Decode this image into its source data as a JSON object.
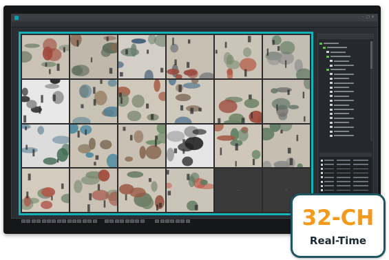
{
  "badge": {
    "title": "32-CH",
    "subtitle": "Real-Time"
  },
  "colors": {
    "accent": "#14b3b8",
    "badge_orange": "#f39a1c",
    "badge_border": "#1f5563"
  },
  "cameras": [
    {
      "state": "live",
      "palette": [
        "#c9c2b5",
        "#7f8a74",
        "#a04a3a"
      ]
    },
    {
      "state": "live",
      "palette": [
        "#bfb8ab",
        "#5d6b5a",
        "#8c6a50"
      ]
    },
    {
      "state": "live",
      "palette": [
        "#d4cfc6",
        "#6a7f6c",
        "#3e5a78"
      ]
    },
    {
      "state": "live",
      "palette": [
        "#c7bfb2",
        "#9a4a3e",
        "#6b6f72"
      ]
    },
    {
      "state": "live",
      "palette": [
        "#cbc4b8",
        "#7b8c72",
        "#b25a44"
      ]
    },
    {
      "state": "live",
      "palette": [
        "#c3beb4",
        "#5f7a60",
        "#8e8e8e"
      ]
    },
    {
      "state": "live",
      "palette": [
        "#e8e8e8",
        "#222222",
        "#8a8a8a"
      ]
    },
    {
      "state": "live",
      "palette": [
        "#c9c3b6",
        "#4e7f96",
        "#8b7152"
      ]
    },
    {
      "state": "live",
      "palette": [
        "#cfc8bb",
        "#6f7f66",
        "#a45c44"
      ]
    },
    {
      "state": "live",
      "palette": [
        "#d0c9bd",
        "#7f6a58",
        "#4a6f8c"
      ]
    },
    {
      "state": "live",
      "palette": [
        "#cdc6b9",
        "#6d8466",
        "#9c4a3c"
      ]
    },
    {
      "state": "live",
      "palette": [
        "#c6c0b4",
        "#5b7060",
        "#707070"
      ]
    },
    {
      "state": "live",
      "palette": [
        "#dcdcdc",
        "#6e8fa0",
        "#3e6a52"
      ]
    },
    {
      "state": "live",
      "palette": [
        "#cbc4b7",
        "#4e8aa0",
        "#7a6a52"
      ]
    },
    {
      "state": "live",
      "palette": [
        "#c8c1b4",
        "#8a6a52",
        "#6a8a64"
      ]
    },
    {
      "state": "live",
      "palette": [
        "#e6e6e6",
        "#1e1e1e",
        "#9a9a9a"
      ]
    },
    {
      "state": "live",
      "palette": [
        "#cec7ba",
        "#5f7f62",
        "#a25a44"
      ]
    },
    {
      "state": "live",
      "palette": [
        "#c5beb1",
        "#5e7a62",
        "#8a8a8a"
      ]
    },
    {
      "state": "live",
      "palette": [
        "#d2cbbe",
        "#6c8268",
        "#b0584a"
      ]
    },
    {
      "state": "live",
      "palette": [
        "#c9c2b5",
        "#7a8a70",
        "#a24c3c"
      ]
    },
    {
      "state": "live",
      "palette": [
        "#cdc6b9",
        "#6f7f66",
        "#9a5a46"
      ]
    },
    {
      "state": "live",
      "palette": [
        "#cbc4b8",
        "#5f7a60",
        "#c25a4a"
      ]
    },
    {
      "state": "empty",
      "palette": [
        "#3a3a3a",
        "#3a3a3a",
        "#3a3a3a"
      ]
    },
    {
      "state": "empty",
      "palette": [
        "#3a3a3a",
        "#3a3a3a",
        "#3a3a3a"
      ]
    }
  ],
  "tree_items": [
    {
      "indent": 0,
      "kind": "group"
    },
    {
      "indent": 1,
      "kind": "group"
    },
    {
      "indent": 2,
      "kind": "cam"
    },
    {
      "indent": 2,
      "kind": "group"
    },
    {
      "indent": 3,
      "kind": "cam"
    },
    {
      "indent": 3,
      "kind": "cam"
    },
    {
      "indent": 2,
      "kind": "group"
    },
    {
      "indent": 3,
      "kind": "cam"
    },
    {
      "indent": 3,
      "kind": "cam"
    },
    {
      "indent": 3,
      "kind": "cam"
    },
    {
      "indent": 3,
      "kind": "cam"
    },
    {
      "indent": 3,
      "kind": "cam"
    },
    {
      "indent": 3,
      "kind": "cam"
    },
    {
      "indent": 3,
      "kind": "cam"
    },
    {
      "indent": 3,
      "kind": "cam"
    },
    {
      "indent": 3,
      "kind": "cam"
    },
    {
      "indent": 3,
      "kind": "cam"
    },
    {
      "indent": 3,
      "kind": "cam"
    },
    {
      "indent": 3,
      "kind": "cam"
    },
    {
      "indent": 3,
      "kind": "cam"
    },
    {
      "indent": 3,
      "kind": "cam"
    },
    {
      "indent": 3,
      "kind": "cam"
    }
  ],
  "event_rows": 12,
  "toolbar_buttons": 30
}
